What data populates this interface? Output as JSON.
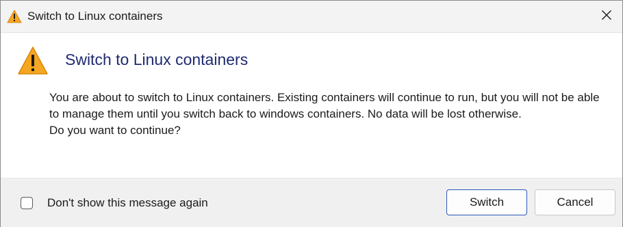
{
  "window": {
    "title": "Switch to Linux containers",
    "close_glyph": "✕",
    "icon": "warning-icon"
  },
  "content": {
    "heading": "Switch to Linux containers",
    "message_line": "You are about to switch to Linux containers. Existing containers will continue to run, but you will not be able to manage them until you switch back to windows containers. No data will be lost otherwise.",
    "question": "Do you want to continue?",
    "icon": "warning-icon"
  },
  "footer": {
    "checkbox_label": "Don't show this message again",
    "checkbox_checked": false,
    "switch_label": "Switch",
    "cancel_label": "Cancel"
  },
  "colors": {
    "heading": "#1f2a70",
    "warning_fill": "#f5a623",
    "primary_border": "#2d57b4",
    "footer_bg": "#f0f0f0"
  }
}
